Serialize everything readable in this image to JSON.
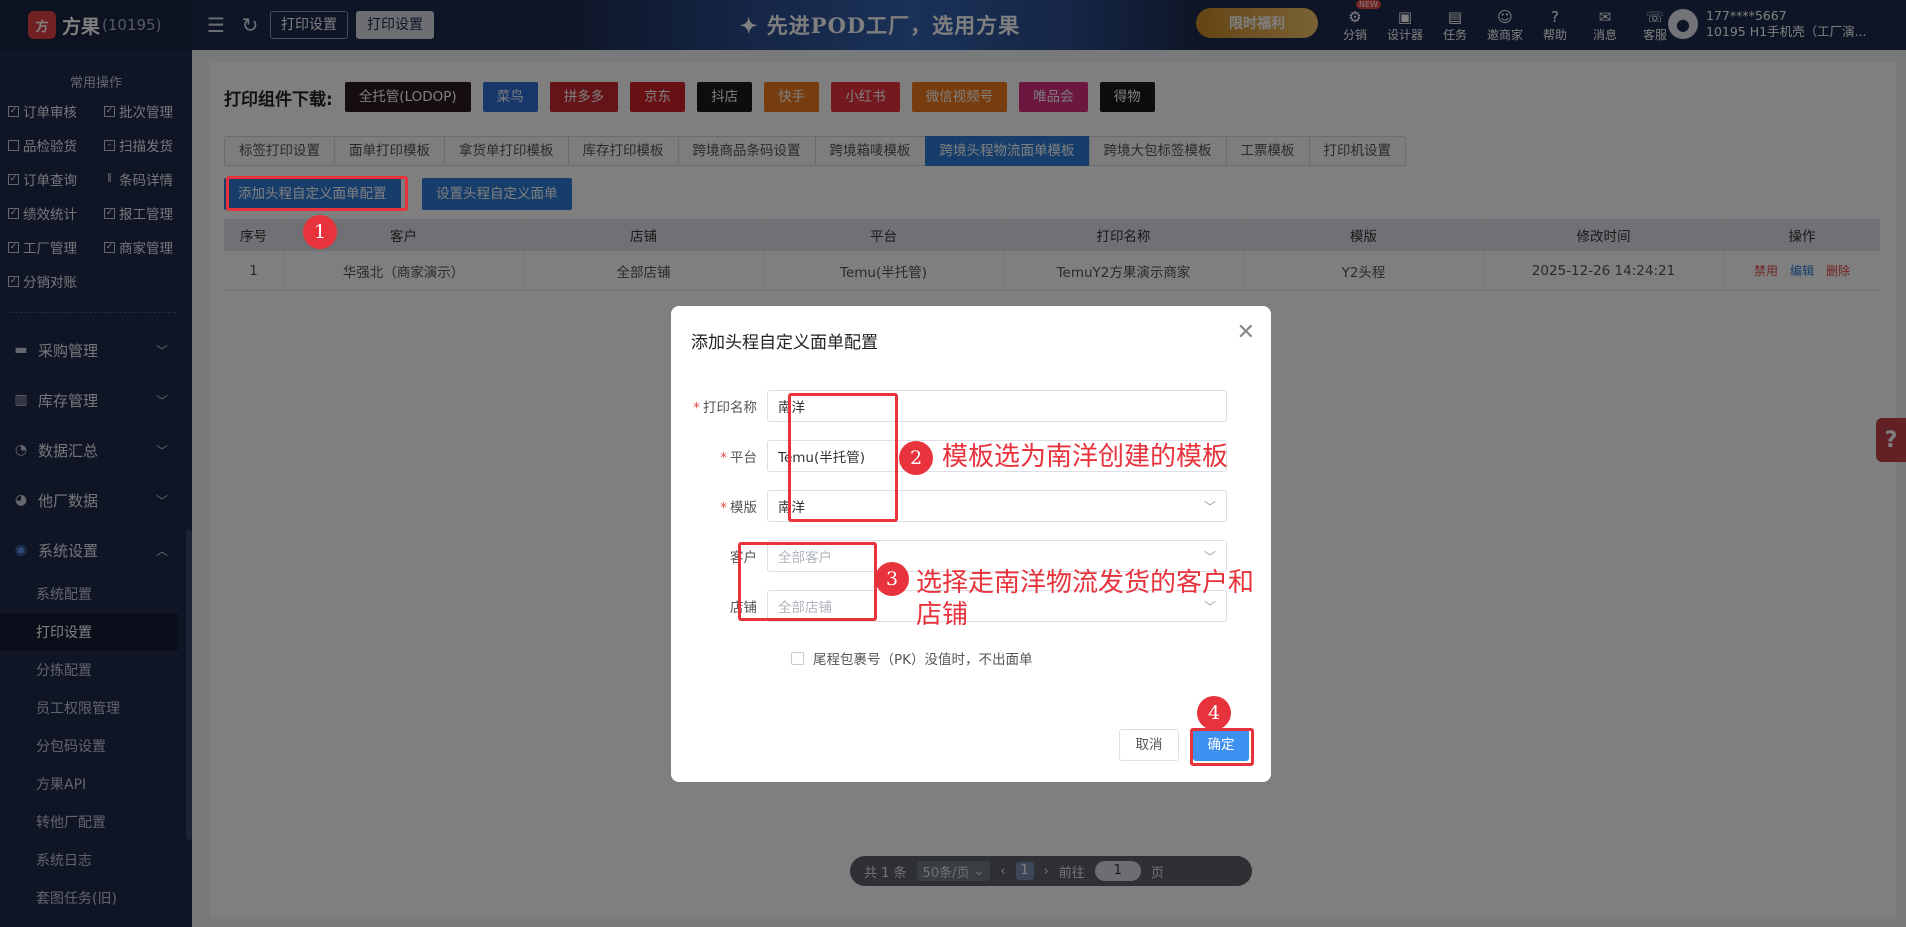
{
  "topbar": {
    "logo_mark": "方",
    "brand": "方果",
    "brand_id": "(10195)",
    "tabs": [
      "打印设置",
      "打印设置"
    ],
    "banner": "✦ 先进POD工厂，选用方果",
    "promo": "限时福利",
    "menu": [
      {
        "label": "分销",
        "icon": "distribution-icon",
        "badge": "NEW"
      },
      {
        "label": "设计器",
        "icon": "designer-icon"
      },
      {
        "label": "任务",
        "icon": "task-icon"
      },
      {
        "label": "邀商家",
        "icon": "invite-icon"
      },
      {
        "label": "帮助",
        "icon": "help-icon"
      },
      {
        "label": "消息",
        "icon": "message-icon"
      },
      {
        "label": "客服",
        "icon": "service-icon"
      }
    ],
    "user_line1": "177****5667",
    "user_line2": "10195 H1手机壳（工厂演..."
  },
  "sidebar": {
    "quick_title": "常用操作",
    "quick": [
      "订单审核",
      "批次管理",
      "品检验货",
      "扫描发货",
      "订单查询",
      "条码详情",
      "绩效统计",
      "报工管理",
      "工厂管理",
      "商家管理",
      "分销对账"
    ],
    "menus": [
      {
        "label": "采购管理",
        "icon": "purchase-icon"
      },
      {
        "label": "库存管理",
        "icon": "inventory-icon"
      },
      {
        "label": "数据汇总",
        "icon": "data-summary-icon"
      },
      {
        "label": "他厂数据",
        "icon": "other-factory-icon"
      },
      {
        "label": "系统设置",
        "icon": "system-settings-icon",
        "expanded": true
      }
    ],
    "sub_items": [
      "系统配置",
      "打印设置",
      "分拣配置",
      "员工权限管理",
      "分包码设置",
      "方果API",
      "转他厂配置",
      "系统日志",
      "套图任务(旧)"
    ],
    "active_sub": "打印设置"
  },
  "main": {
    "download_title": "打印组件下载:",
    "download_buttons": [
      {
        "label": "全托管(LODOP)",
        "color": "#2a1a1f"
      },
      {
        "label": "菜鸟",
        "color": "#2e6fd6"
      },
      {
        "label": "拼多多",
        "color": "#c8262e"
      },
      {
        "label": "京东",
        "color": "#d0232b"
      },
      {
        "label": "抖店",
        "color": "#1a1a1a"
      },
      {
        "label": "快手",
        "color": "#f07a1e"
      },
      {
        "label": "小红书",
        "color": "#e8323c"
      },
      {
        "label": "微信视频号",
        "color": "#f07a1e"
      },
      {
        "label": "唯品会",
        "color": "#d62e7e"
      },
      {
        "label": "得物",
        "color": "#1a1a1a"
      }
    ],
    "tabs": [
      "标签打印设置",
      "面单打印模板",
      "拿货单打印模板",
      "库存打印模板",
      "跨境商品条码设置",
      "跨境箱唛模板",
      "跨境头程物流面单模板",
      "跨境大包标签模板",
      "工票模板",
      "打印机设置"
    ],
    "active_tab": 6,
    "add_button": "添加头程自定义面单配置",
    "set_button": "设置头程自定义面单",
    "columns": [
      "序号",
      "客户",
      "店铺",
      "平台",
      "打印名称",
      "模版",
      "修改时间",
      "操作"
    ],
    "rows": [
      {
        "no": "1",
        "customer": "华强北（商家演示）",
        "shop": "全部店铺",
        "platform": "Temu(半托管)",
        "print_name": "TemuY2方果演示商家",
        "template": "Y2头程",
        "modified": "2025-12-26 14:24:21"
      }
    ],
    "row_ops": [
      "禁用",
      "编辑",
      "删除"
    ],
    "pager": {
      "total": "共 1 条",
      "page_size": "50条/页",
      "current": "1",
      "goto_label": "前往",
      "goto_value": "1",
      "page_unit": "页"
    },
    "help_tab": "?"
  },
  "dialog": {
    "title": "添加头程自定义面单配置",
    "fields": [
      {
        "label": "打印名称",
        "value": "南洋",
        "required": true
      },
      {
        "label": "平台",
        "value": "Temu(半托管)",
        "required": true
      },
      {
        "label": "模版",
        "value": "南洋",
        "required": true
      },
      {
        "label": "客户",
        "placeholder": "全部客户",
        "required": false
      },
      {
        "label": "店铺",
        "placeholder": "全部店铺",
        "required": false
      }
    ],
    "required_mark": "*",
    "pk_checkbox": "尾程包裹号（PK）没值时，不出面单",
    "cancel": "取消",
    "confirm": "确定"
  },
  "annotations": {
    "badges": [
      "1",
      "2",
      "3",
      "4"
    ],
    "note2": "模板选为南洋创建的模板",
    "note3": "选择走南洋物流发货的客户和店铺"
  }
}
